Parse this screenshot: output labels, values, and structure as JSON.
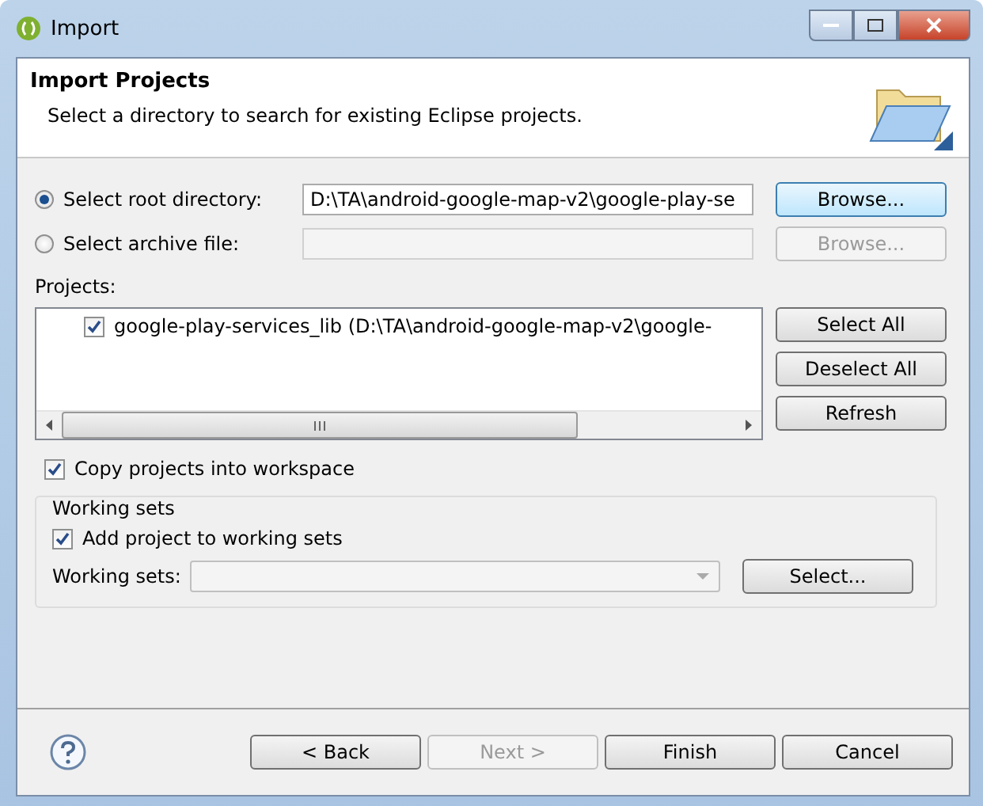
{
  "window": {
    "title": "Import"
  },
  "header": {
    "title": "Import Projects",
    "description": "Select a directory to search for existing Eclipse projects."
  },
  "source": [
    {
      "label": "Select root directory:",
      "selected": true,
      "value": "D:\\TA\\android-google-map-v2\\google-play-se",
      "button": {
        "label": "Browse...",
        "disabled": false
      }
    },
    {
      "label": "Select archive file:",
      "selected": false,
      "button": {
        "label": "Browse...",
        "disabled": true
      }
    }
  ],
  "projects": {
    "label": "Projects:",
    "items": [
      {
        "label": "google-play-services_lib (D:\\TA\\android-google-map-v2\\google-",
        "checked": true
      }
    ],
    "buttons": [
      "Select All",
      "Deselect All",
      "Refresh"
    ]
  },
  "copy_option": {
    "label": "Copy projects into workspace",
    "checked": true
  },
  "working_sets": {
    "title": "Working sets",
    "add_option": {
      "label": "Add project to working sets",
      "checked": true
    },
    "field_label": "Working sets:",
    "button": "Select..."
  },
  "footer": {
    "buttons": [
      {
        "label": "< Back",
        "disabled": false
      },
      {
        "label": "Next >",
        "disabled": true
      },
      {
        "label": "Finish",
        "disabled": false
      },
      {
        "label": "Cancel",
        "disabled": false
      }
    ]
  }
}
